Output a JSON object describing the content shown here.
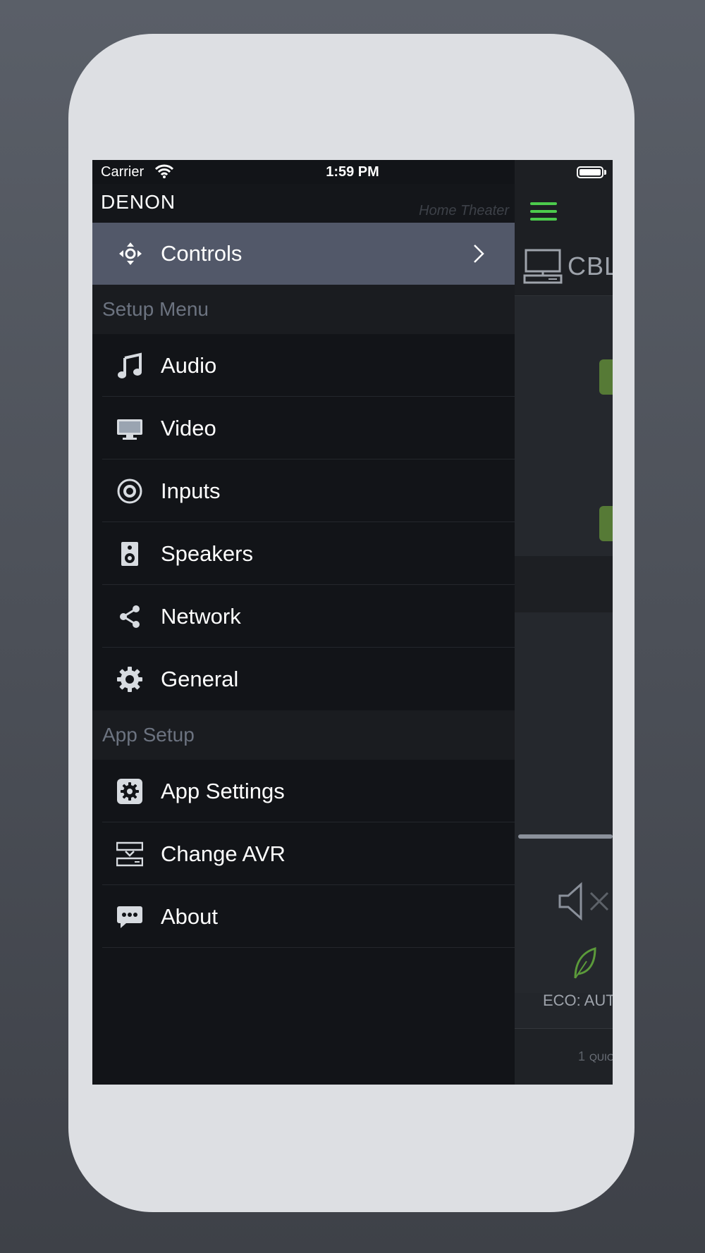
{
  "status_bar": {
    "carrier": "Carrier",
    "time": "1:59 PM"
  },
  "header": {
    "brand": "DENON",
    "subtitle": "Home Theater"
  },
  "controls": {
    "label": "Controls"
  },
  "setup_menu": {
    "title": "Setup Menu",
    "items": [
      {
        "label": "Audio",
        "icon": "music-note-icon"
      },
      {
        "label": "Video",
        "icon": "monitor-icon"
      },
      {
        "label": "Inputs",
        "icon": "input-ring-icon"
      },
      {
        "label": "Speakers",
        "icon": "speaker-icon"
      },
      {
        "label": "Network",
        "icon": "share-icon"
      },
      {
        "label": "General",
        "icon": "gear-icon"
      }
    ]
  },
  "app_setup": {
    "title": "App Setup",
    "items": [
      {
        "label": "App Settings",
        "icon": "settings-box-icon"
      },
      {
        "label": "Change AVR",
        "icon": "change-avr-icon"
      },
      {
        "label": "About",
        "icon": "chat-bubble-icon"
      }
    ]
  },
  "main": {
    "source_label": "CBL",
    "eco_label": "ECO: AUT",
    "quick_number": "1",
    "quick_label": "QUIC"
  },
  "colors": {
    "accent_green": "#4ccb4c",
    "controls_bg": "#525869",
    "drawer_bg": "#121418"
  }
}
